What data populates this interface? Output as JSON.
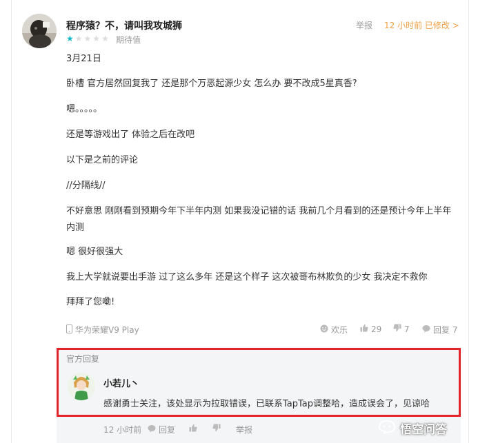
{
  "review": {
    "username": "程序猿？不，请叫我攻城狮",
    "rating": 1,
    "rating_max": 5,
    "rating_label": "期待值",
    "report_label": "举报",
    "time_label": "12 小时前 已修改 >",
    "paragraphs": [
      "3月21日",
      "卧槽 官方居然回复我了 还是那个万恶起源少女 怎么办 要不改成5星真香?",
      "嗯。。。。。",
      "还是等游戏出了 体验之后在改吧",
      "以下是之前的评论",
      "//分隔线//",
      "不好意思 刚刚看到预期今年下半年内测 如果我没记错的话 我前几个月看到的还是预计今年上半年内测",
      "嗯 很好很强大",
      "我上大学就说要出手游 过了这么多年 还是这个样子 这次被哥布林欺负的少女 我决定不救你",
      "拜拜了您嘞!"
    ],
    "device": "华为荣耀V9 Play",
    "actions": {
      "fun": "欢乐",
      "like_count": "29",
      "dislike_count": "7",
      "reply": "回复 7"
    }
  },
  "official_reply": {
    "section_label": "官方回复",
    "name": "小若儿丶",
    "text": "感谢勇士关注，该处显示为拉取错误，已联系TapTap调整哈，造成误会了，见谅哈",
    "time": "12 小时前",
    "reply_label": "回复",
    "report_label": "举报"
  },
  "watermark": {
    "text": "悟空问答"
  },
  "colors": {
    "accent_teal": "#14b9c8",
    "time_orange": "#f0a044",
    "highlight_red": "#e2232a"
  }
}
